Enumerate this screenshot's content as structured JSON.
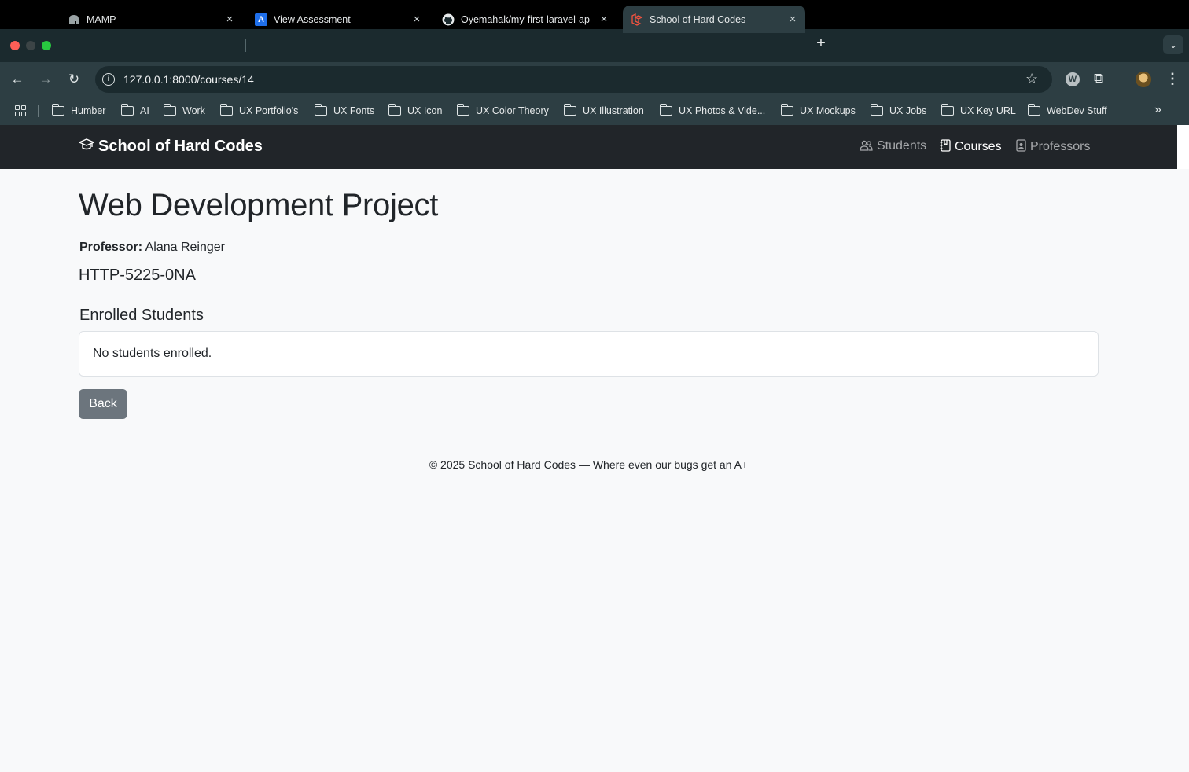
{
  "browser": {
    "tabs": [
      {
        "title": "MAMP",
        "active": false
      },
      {
        "title": "View Assessment",
        "active": false
      },
      {
        "title": "Oyemahak/my-first-laravel-ap",
        "active": false
      },
      {
        "title": "School of Hard Codes",
        "active": true
      }
    ],
    "address": "127.0.0.1:8000/courses/14",
    "bookmarks": [
      "Humber",
      "AI",
      "Work",
      "UX Portfolio's",
      "UX Fonts",
      "UX Icon",
      "UX Color Theory",
      "UX Illustration",
      "UX Photos & Vide...",
      "UX Mockups",
      "UX Jobs",
      "UX Key URL",
      "WebDev Stuff"
    ]
  },
  "navbar": {
    "brand": "School of Hard Codes",
    "links": [
      {
        "label": "Students",
        "active": false
      },
      {
        "label": "Courses",
        "active": true
      },
      {
        "label": "Professors",
        "active": false
      }
    ]
  },
  "course": {
    "title": "Web Development Project",
    "professor_label": "Professor:",
    "professor_name": "Alana Reinger",
    "code": "HTTP-5225-0NA"
  },
  "enrolled": {
    "heading": "Enrolled Students",
    "empty_message": "No students enrolled."
  },
  "back_label": "Back",
  "footer": "© 2025 School of Hard Codes — Where even our bugs get an A+"
}
